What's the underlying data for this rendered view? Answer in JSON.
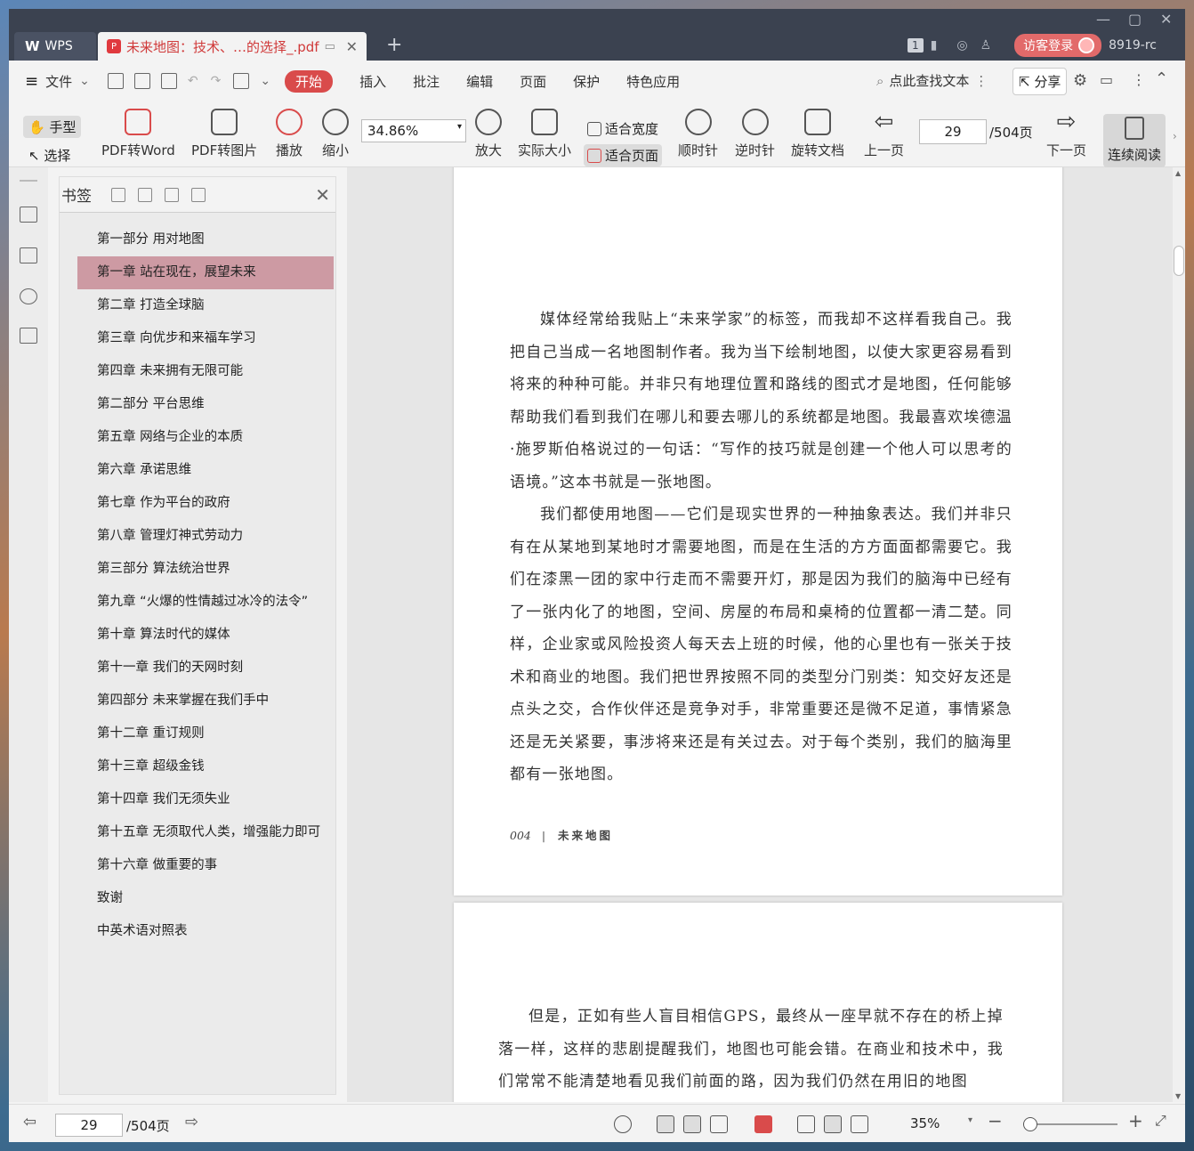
{
  "titlebar": {
    "app_name": "WPS",
    "doc_tab_name": "未来地图：技术、…的选择_.pdf",
    "badge": "1",
    "login_label": "访客登录",
    "user_id": "8919-rc"
  },
  "menubar": {
    "file_label": "文件",
    "tabs": [
      "开始",
      "插入",
      "批注",
      "编辑",
      "页面",
      "保护",
      "特色应用"
    ],
    "search_label": "点此查找文本",
    "share_label": "分享"
  },
  "toolbar": {
    "hand": "手型",
    "select": "选择",
    "pdf_to_word": "PDF转Word",
    "pdf_to_image": "PDF转图片",
    "play": "播放",
    "zoom_out": "缩小",
    "zoom_value": "34.86%",
    "zoom_in": "放大",
    "actual_size": "实际大小",
    "fit_width": "适合宽度",
    "fit_page": "适合页面",
    "clockwise": "顺时针",
    "counterclockwise": "逆时针",
    "rotate_doc": "旋转文档",
    "prev_page": "上一页",
    "page_value": "29",
    "page_total": "/504页",
    "next_page": "下一页",
    "continuous": "连续阅读"
  },
  "bookmarks": {
    "title": "书签",
    "items": [
      "第一部分 用对地图",
      "第一章 站在现在，展望未来",
      "第二章 打造全球脑",
      "第三章 向优步和来福车学习",
      "第四章 未来拥有无限可能",
      "第二部分 平台思维",
      "第五章 网络与企业的本质",
      "第六章 承诺思维",
      "第七章 作为平台的政府",
      "第八章 管理灯神式劳动力",
      "第三部分 算法统治世界",
      "第九章 “火爆的性情越过冰冷的法令”",
      "第十章 算法时代的媒体",
      "第十一章 我们的天网时刻",
      "第四部分 未来掌握在我们手中",
      "第十二章 重订规则",
      "第十三章 超级金钱",
      "第十四章 我们无须失业",
      "第十五章 无须取代人类，增强能力即可",
      "第十六章 做重要的事",
      "致谢",
      "中英术语对照表"
    ],
    "active_index": 1
  },
  "document": {
    "page1_paragraphs": [
      "媒体经常给我贴上“未来学家”的标签，而我却不这样看我自己。我把自己当成一名地图制作者。我为当下绘制地图，以使大家更容易看到将来的种种可能。并非只有地理位置和路线的图式才是地图，任何能够帮助我们看到我们在哪儿和要去哪儿的系统都是地图。我最喜欢埃德温·施罗斯伯格说过的一句话：“写作的技巧就是创建一个他人可以思考的语境。”这本书就是一张地图。",
      "我们都使用地图——它们是现实世界的一种抽象表达。我们并非只有在从某地到某地时才需要地图，而是在生活的方方面面都需要它。我们在漆黑一团的家中行走而不需要开灯，那是因为我们的脑海中已经有了一张内化了的地图，空间、房屋的布局和桌椅的位置都一清二楚。同样，企业家或风险投资人每天去上班的时候，他的心里也有一张关于技术和商业的地图。我们把世界按照不同的类型分门别类：知交好友还是点头之交，合作伙伴还是竞争对手，非常重要还是微不足道，事情紧急还是无关紧要，事涉将来还是有关过去。对于每个类别，我们的脑海里都有一张地图。"
    ],
    "page1_footer_num": "004",
    "page1_footer_sep": "|",
    "page1_footer_title": "未来地图",
    "page2_paragraph": "但是，正如有些人盲目相信GPS，最终从一座早就不存在的桥上掉落一样，这样的悲剧提醒我们，地图也可能会错。在商业和技术中，我们常常不能清楚地看见我们前面的路，因为我们仍然在用旧的地图"
  },
  "statusbar": {
    "page_value": "29",
    "page_total": "/504页",
    "zoom_value": "35%"
  },
  "colors": {
    "accent": "#d94b4b",
    "bookmark_active": "#cd9aa3",
    "titlebar": "#3b4250"
  }
}
